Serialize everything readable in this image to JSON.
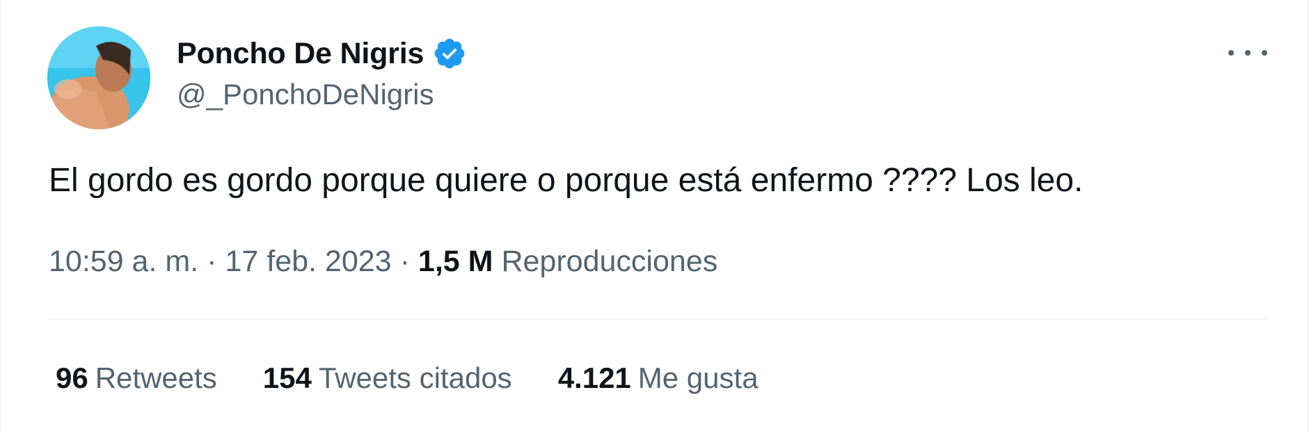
{
  "author": {
    "name": "Poncho De Nigris",
    "handle": "@_PonchoDeNigris",
    "verified": true,
    "verified_color": "#1d9bf0"
  },
  "tweet": {
    "text": "El gordo es gordo porque quiere o porque está enfermo ???? Los leo.",
    "time": "10:59 a. m.",
    "separator": "·",
    "date": "17 feb. 2023",
    "views_count": "1,5 M",
    "views_label": "Reproducciones"
  },
  "stats": {
    "retweets": {
      "count": "96",
      "label": "Retweets"
    },
    "quotes": {
      "count": "154",
      "label": "Tweets citados"
    },
    "likes": {
      "count": "4.121",
      "label": "Me gusta"
    }
  },
  "icons": {
    "more": "more-horizontal-icon",
    "verified": "verified-badge-icon"
  },
  "colors": {
    "text_primary": "#0f1419",
    "text_secondary": "#536471",
    "divider": "#eff3f4"
  }
}
